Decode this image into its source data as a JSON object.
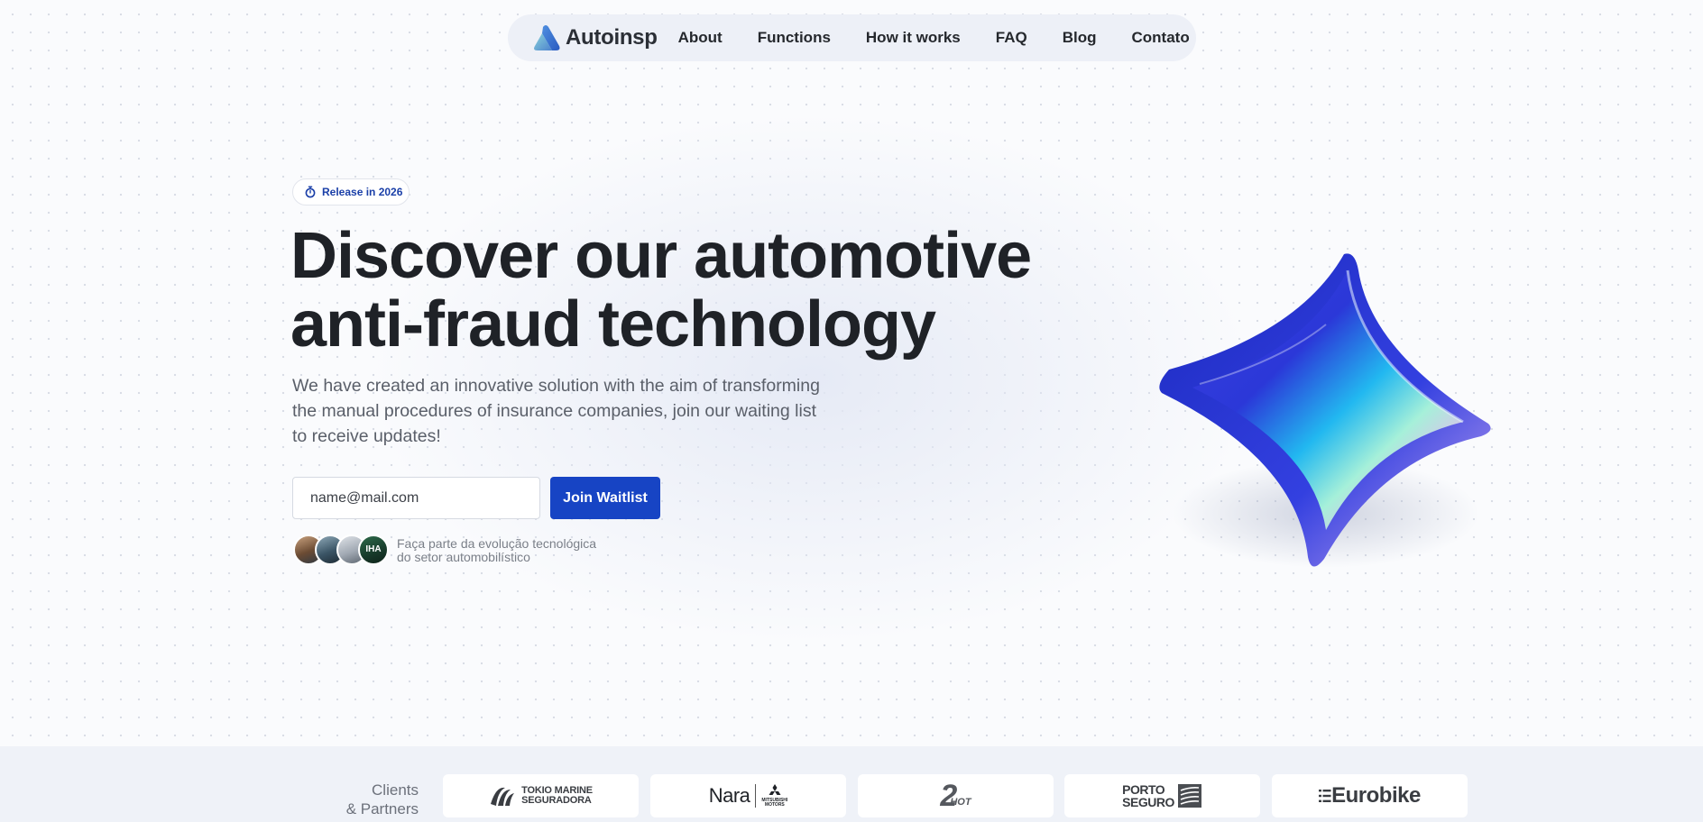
{
  "nav": {
    "brand": "Autoinsp",
    "links": [
      "About",
      "Functions",
      "How it works",
      "FAQ",
      "Blog",
      "Contato"
    ]
  },
  "hero": {
    "badge": "Release in 2026",
    "headline_line1": "Discover our automotive",
    "headline_line2": "anti-fraud technology",
    "subtext": "We have created an innovative solution with the aim of transforming the manual procedures of insurance companies, join our waiting list to receive updates!",
    "email_placeholder": "name@mail.com",
    "join_label": "Join Waitlist",
    "social_proof_line1": "Faça parte da evolução tecnológica",
    "social_proof_line2": "do setor automobilístico",
    "avatar_badge": "IHA"
  },
  "clients": {
    "label_line1": "Clients",
    "label_line2": "& Partners",
    "logos": {
      "tokio_line1": "TOKIO MARINE",
      "tokio_line2": "SEGURADORA",
      "nara": "Nara",
      "mitsubishi_line1": "MITSUBISHI",
      "mitsubishi_line2": "MOTORS",
      "twohot_digit": "2",
      "twohot_word": "HOT",
      "porto_line1": "PORTO",
      "porto_line2": "SEGURO",
      "eurobike": "Eurobike"
    }
  },
  "colors": {
    "accent": "#1744c4",
    "badge_text": "#1a3fa8",
    "nav_bg": "#edf0f7",
    "clients_bg": "#eff2f8"
  }
}
